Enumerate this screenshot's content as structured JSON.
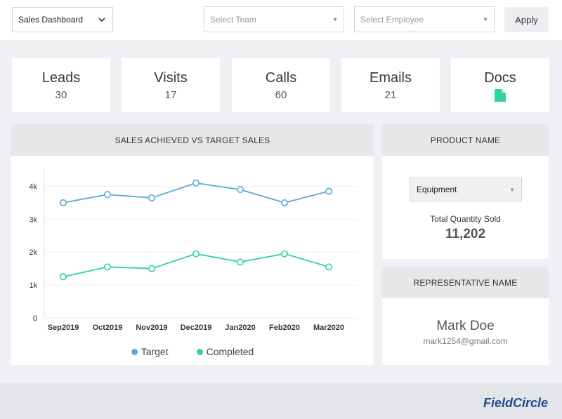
{
  "topbar": {
    "dashboard_select": "Sales Dashboard",
    "team_placeholder": "Select Team",
    "employee_placeholder": "Select Employee",
    "apply_label": "Apply"
  },
  "stats": [
    {
      "title": "Leads",
      "value": "30"
    },
    {
      "title": "Visits",
      "value": "17"
    },
    {
      "title": "Calls",
      "value": "60"
    },
    {
      "title": "Emails",
      "value": "21"
    },
    {
      "title": "Docs",
      "icon": "document-icon"
    }
  ],
  "colors": {
    "target": "#5aa8d6",
    "completed": "#2ed49a",
    "doc_icon": "#2ed49a",
    "brand": "#1f4b8e"
  },
  "chart_panel": {
    "title": "SALES ACHIEVED VS TARGET SALES"
  },
  "chart_data": {
    "type": "line",
    "categories": [
      "Sep2019",
      "Oct2019",
      "Nov2019",
      "Dec2019",
      "Jan2020",
      "Feb2020",
      "Mar2020"
    ],
    "series": [
      {
        "name": "Target",
        "values": [
          3500,
          3750,
          3650,
          4100,
          3900,
          3500,
          3850
        ]
      },
      {
        "name": "Completed",
        "values": [
          1250,
          1550,
          1500,
          1950,
          1700,
          1950,
          1550
        ]
      }
    ],
    "ylim": [
      0,
      4500
    ],
    "yticks": [
      "0",
      "1k",
      "2k",
      "3k",
      "4k"
    ],
    "ytick_values": [
      0,
      1000,
      2000,
      3000,
      4000
    ],
    "grid": true,
    "legend": "bottom"
  },
  "product_panel": {
    "title": "PRODUCT NAME",
    "selected_product": "Equipment",
    "qty_label": "Total Quantity Sold",
    "qty_value": "11,202"
  },
  "rep_panel": {
    "title": "REPRESENTATIVE NAME",
    "name": "Mark Doe",
    "email": "mark1254@gmail.com"
  },
  "footer": {
    "brand": "FieldCircle"
  }
}
